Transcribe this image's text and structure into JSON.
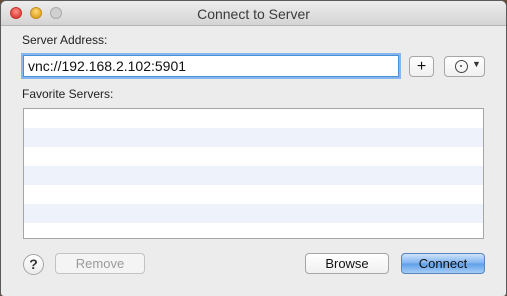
{
  "window": {
    "title": "Connect to Server",
    "traffic_lights": [
      "close",
      "minimize",
      "zoom"
    ]
  },
  "server_address": {
    "label": "Server Address:",
    "value": "vnc://192.168.2.102:5901"
  },
  "buttons": {
    "add": "+",
    "recent_icon": "clock-icon",
    "help": "?",
    "remove": "Remove",
    "browse": "Browse",
    "connect": "Connect"
  },
  "favorites": {
    "label": "Favorite Servers:",
    "items": []
  },
  "colors": {
    "accent": "#5e9ee8",
    "row_alt": "#eef3fb",
    "focus_ring": "#86b6eb"
  }
}
